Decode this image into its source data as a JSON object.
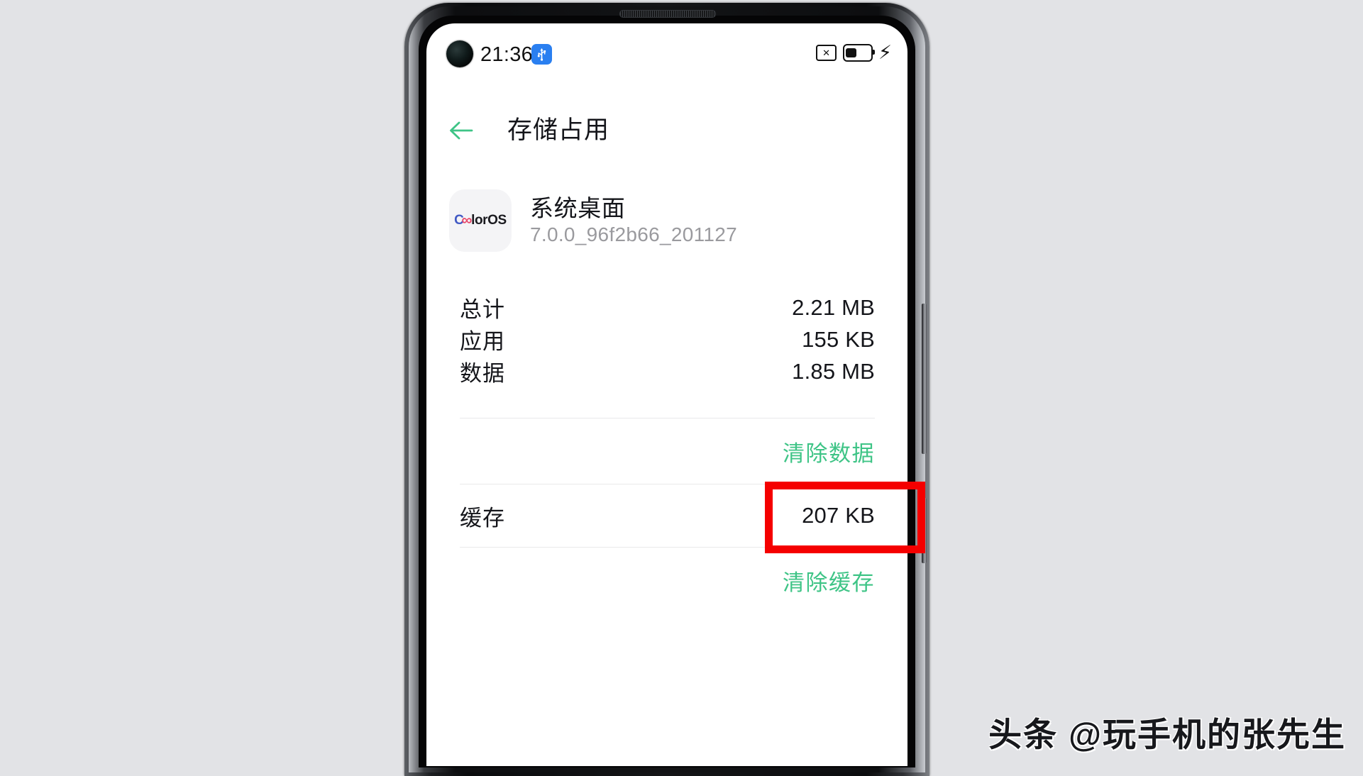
{
  "background_color": "#e2e3e6",
  "accent_color": "#3ec486",
  "annotation_color": "#f50000",
  "status_bar": {
    "time": "21:36",
    "usb_icon": "usb-icon",
    "camera_icon": "punch-hole-camera",
    "mute_icon": "silent-mode-icon",
    "mute_glyph": "✕",
    "battery_icon": "battery-icon",
    "charging_icon": "charging-bolt-icon",
    "charging_glyph": "⚡"
  },
  "app_bar": {
    "back_icon": "back-arrow-icon",
    "title": "存储占用"
  },
  "app_header": {
    "icon_name": "coloros-app-icon",
    "icon_text_c": "C",
    "icon_text_o": "∞",
    "icon_text_rest": "lorOS",
    "app_name": "系统桌面",
    "version": "7.0.0_96f2b66_201127"
  },
  "storage": {
    "rows": [
      {
        "label": "总计",
        "value": "2.21 MB"
      },
      {
        "label": "应用",
        "value": "155 KB"
      },
      {
        "label": "数据",
        "value": "1.85 MB"
      }
    ],
    "clear_data_label": "清除数据",
    "cache_row": {
      "label": "缓存",
      "value": "207 KB"
    },
    "clear_cache_label": "清除缓存"
  },
  "watermark": {
    "text": "头条 @玩手机的张先生"
  }
}
